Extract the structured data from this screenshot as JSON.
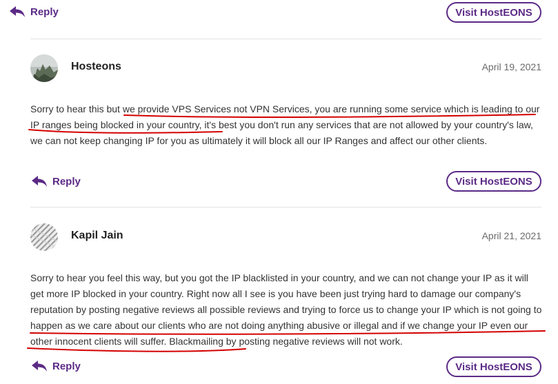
{
  "reply_label": "Reply",
  "visit_label": "Visit HostEONS",
  "comments": [
    {
      "author": "Hosteons",
      "date": "April 19, 2021",
      "text": "Sorry to hear this but we provide VPS Services not VPN Services, you are running some service which is leading to our IP ranges being blocked in your country, it's best you don't run any services that are not allowed by your country's law, we can not keep changing IP for you as ultimately it will block all our IP Ranges and affect our other clients."
    },
    {
      "author": "Kapil Jain",
      "date": "April 21, 2021",
      "text": "Sorry to hear you feel this way, but you got the IP blacklisted in your country, and we can not change your IP as it will get more IP blocked in your country. Right now all I see is you have been just trying hard to damage our company's reputation by posting negative reviews all possible reviews and trying to force us to change your IP which is not going to happen as we care about our clients who are not doing anything abusive or illegal and if we change your IP even our other innocent clients will suffer. Blackmailing by posting negative reviews will not work."
    }
  ],
  "colors": {
    "accent": "#5b2a86",
    "annotation": "#d40000"
  },
  "icons": {
    "reply": "reply-arrow-icon"
  }
}
